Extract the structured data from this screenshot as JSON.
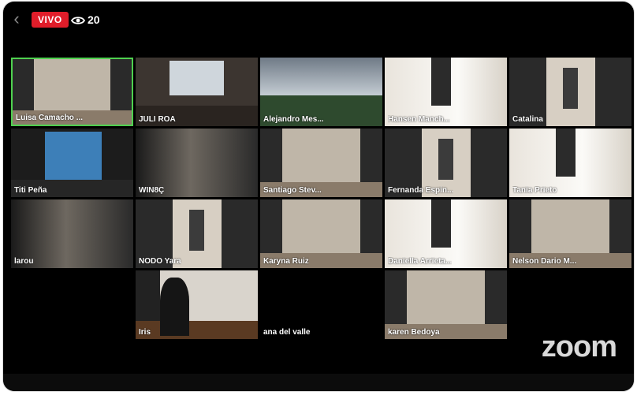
{
  "topbar": {
    "live_label": "VIVO",
    "viewer_count": "20"
  },
  "participants": [
    {
      "name": "Luisa Camacho ...",
      "active": true,
      "scene": "room"
    },
    {
      "name": "JULI ROA",
      "active": false,
      "scene": "window"
    },
    {
      "name": "Alejandro Mes...",
      "active": false,
      "scene": "sky"
    },
    {
      "name": "Hansen Manch...",
      "active": false,
      "scene": "bright"
    },
    {
      "name": "Catalina",
      "active": false,
      "scene": "door"
    },
    {
      "name": "Titi Peña",
      "active": false,
      "scene": "blue"
    },
    {
      "name": "WIN8Ç",
      "active": false,
      "scene": "dark"
    },
    {
      "name": "Santiago Stev...",
      "active": false,
      "scene": "room"
    },
    {
      "name": "Fernanda Espin...",
      "active": false,
      "scene": "door"
    },
    {
      "name": "Tania Prieto",
      "active": false,
      "scene": "bright"
    },
    {
      "name": "larou",
      "active": false,
      "scene": "dark"
    },
    {
      "name": "NODO Yara",
      "active": false,
      "scene": "door"
    },
    {
      "name": "Karyna Ruiz",
      "active": false,
      "scene": "room"
    },
    {
      "name": "Daniella Arrieta...",
      "active": false,
      "scene": "bright"
    },
    {
      "name": "Nelson Dario M...",
      "active": false,
      "scene": "room"
    },
    {
      "name": "Iris",
      "active": false,
      "scene": "wood"
    },
    {
      "name": "ana del valle",
      "active": false,
      "scene": "none"
    },
    {
      "name": "karen Bedoya",
      "active": false,
      "scene": "room"
    }
  ],
  "branding": {
    "logo_text": "zoom"
  },
  "colors": {
    "live_red": "#e11d2a",
    "active_speaker": "#4fd14f"
  }
}
